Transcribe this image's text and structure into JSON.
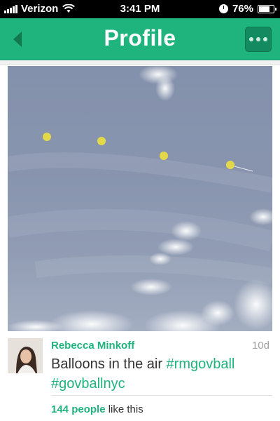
{
  "status_bar": {
    "carrier": "Verizon",
    "time": "3:41 PM",
    "battery": "76%",
    "battery_level": 0.76
  },
  "nav": {
    "title": "Profile",
    "back_icon": "chevron-left-icon",
    "more_icon": "ellipsis-icon"
  },
  "post": {
    "author": "Rebecca Minkoff",
    "time": "10d",
    "caption_text": "Balloons in the air",
    "hashtags": [
      "#rmgovball",
      "#govballnyc"
    ],
    "likes_count": "144 people",
    "likes_suffix": "like this"
  },
  "colors": {
    "accent": "#1fb37e",
    "accent_dark": "#138a5f"
  }
}
